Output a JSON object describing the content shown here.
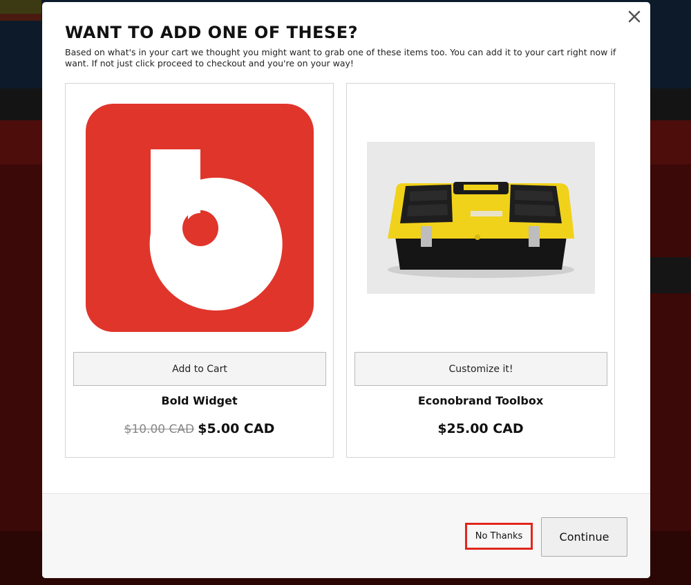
{
  "modal": {
    "title": "WANT TO ADD ONE OF THESE?",
    "description": "Based on what's in your cart we thought you might want to grab one of these items too. You can add it to your cart right now if want. If not just click proceed to checkout and you're on your way!",
    "close_icon": "close-icon"
  },
  "products": [
    {
      "name": "Bold Widget",
      "button_label": "Add to Cart",
      "old_price": "$10.00 CAD",
      "price": "$5.00 CAD",
      "image": "bold-logo",
      "image_color": "#e0352b"
    },
    {
      "name": "Econobrand Toolbox",
      "button_label": "Customize it!",
      "old_price": "",
      "price": "$25.00 CAD",
      "image": "toolbox-photo",
      "image_color": "#f3d515"
    }
  ],
  "footer": {
    "no_thanks_label": "No Thanks",
    "continue_label": "Continue",
    "highlight_color": "#e0261c"
  }
}
